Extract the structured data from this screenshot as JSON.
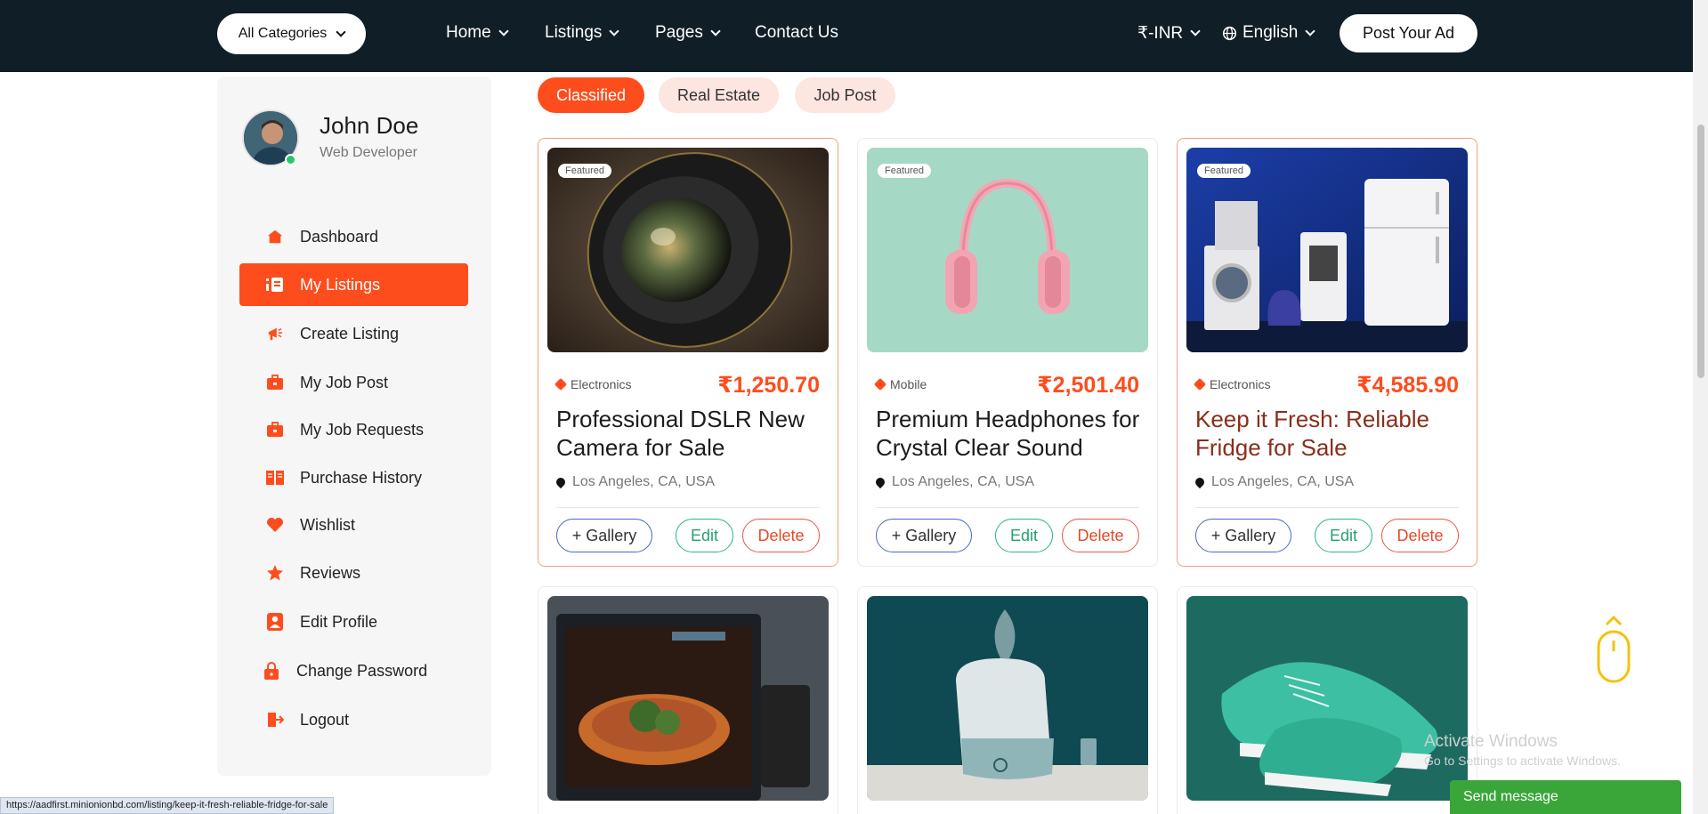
{
  "navbar": {
    "category_button": "All Categories",
    "links": [
      "Home",
      "Listings",
      "Pages",
      "Contact Us"
    ],
    "currency": "₹-INR",
    "language": "English",
    "post_ad": "Post Your Ad"
  },
  "profile": {
    "name": "John Doe",
    "role": "Web Developer"
  },
  "sidebar": {
    "items": [
      {
        "label": "Dashboard",
        "icon": "home-icon"
      },
      {
        "label": "My Listings",
        "icon": "list-icon",
        "active": true
      },
      {
        "label": "Create Listing",
        "icon": "megaphone-icon"
      },
      {
        "label": "My Job Post",
        "icon": "briefcase-icon"
      },
      {
        "label": "My Job Requests",
        "icon": "briefcase-icon"
      },
      {
        "label": "Purchase History",
        "icon": "book-icon"
      },
      {
        "label": "Wishlist",
        "icon": "heart-icon"
      },
      {
        "label": "Reviews",
        "icon": "star-icon"
      },
      {
        "label": "Edit Profile",
        "icon": "user-icon"
      },
      {
        "label": "Change Password",
        "icon": "lock-icon"
      },
      {
        "label": "Logout",
        "icon": "logout-icon"
      }
    ]
  },
  "tabs": [
    "Classified",
    "Real Estate",
    "Job Post"
  ],
  "active_tab": "Classified",
  "listings": [
    {
      "badge": "Featured",
      "category": "Electronics",
      "price": "₹1,250.70",
      "title": "Professional DSLR New Camera for Sale",
      "location": "Los Angeles, CA, USA",
      "image": "camera-lens"
    },
    {
      "badge": "Featured",
      "category": "Mobile",
      "price": "₹2,501.40",
      "title": "Premium Headphones for Crystal Clear Sound",
      "location": "Los Angeles, CA, USA",
      "image": "pink-headphones"
    },
    {
      "badge": "Featured",
      "category": "Electronics",
      "price": "₹4,585.90",
      "title": "Keep it Fresh: Reliable Fridge for Sale",
      "location": "Los Angeles, CA, USA",
      "image": "home-appliances"
    },
    {
      "image": "oven-pizza"
    },
    {
      "image": "humidifier"
    },
    {
      "image": "green-sneakers"
    }
  ],
  "buttons": {
    "gallery": "+ Gallery",
    "edit": "Edit",
    "delete": "Delete"
  },
  "status_url": "https://aadfirst.minionionbd.com/listing/keep-it-fresh-reliable-fridge-for-sale",
  "watermark": {
    "line1": "Activate Windows",
    "line2": "Go to Settings to activate Windows."
  },
  "chat_widget": "Send message",
  "colors": {
    "accent": "#fd4d1d",
    "navbar": "#0f1e27",
    "edit": "#28b67c",
    "gallery": "#4a67c8",
    "chat": "#3aa63a"
  }
}
